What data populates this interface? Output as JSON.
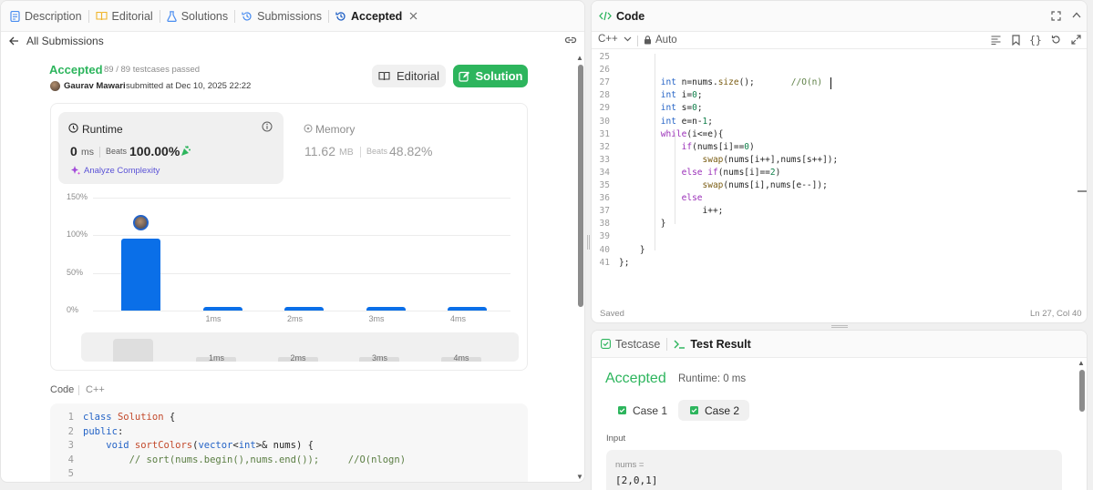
{
  "left_tabs": {
    "description": "Description",
    "editorial": "Editorial",
    "solutions": "Solutions",
    "submissions": "Submissions",
    "accepted": "Accepted"
  },
  "back_link": "All Submissions",
  "submission": {
    "status": "Accepted",
    "testcases": "89 / 89 testcases passed",
    "user": "Gaurav Mawari",
    "submitted_at": "submitted at Dec 10, 2025 22:22",
    "editorial_button": "Editorial",
    "solution_button": "Solution"
  },
  "runtime": {
    "label": "Runtime",
    "value": "0",
    "unit": "ms",
    "beats_label": "Beats",
    "beats_value": "100.00%",
    "analyze": "Analyze Complexity"
  },
  "memory": {
    "label": "Memory",
    "value": "11.62",
    "unit": "MB",
    "beats_label": "Beats",
    "beats_value": "48.82%"
  },
  "chart_data": {
    "type": "bar",
    "categories": [
      "0ms",
      "1ms",
      "2ms",
      "3ms",
      "4ms"
    ],
    "x_tick_labels": [
      "",
      "1ms",
      "2ms",
      "3ms",
      "4ms"
    ],
    "values": [
      95,
      3,
      3,
      3,
      3
    ],
    "ylim": [
      0,
      150
    ],
    "y_ticks": [
      "150%",
      "100%",
      "50%",
      "0%"
    ],
    "grid": true,
    "highlight_category": "0ms",
    "mini_labels": [
      "1ms",
      "2ms",
      "3ms",
      "4ms"
    ]
  },
  "code_section": {
    "label": "Code",
    "language": "C++",
    "lines": [
      {
        "n": "1",
        "tokens": [
          [
            "kw",
            "class "
          ],
          [
            "cls",
            "Solution "
          ],
          [
            "",
            "{"
          ]
        ]
      },
      {
        "n": "2",
        "tokens": [
          [
            "kw",
            "public"
          ],
          [
            "",
            ":"
          ]
        ]
      },
      {
        "n": "3",
        "tokens": [
          [
            "",
            "    "
          ],
          [
            "ty",
            "void "
          ],
          [
            "cls",
            "sortColors"
          ],
          [
            "",
            "("
          ],
          [
            "ty",
            "vector"
          ],
          [
            "",
            "<"
          ],
          [
            "ty",
            "int"
          ],
          [
            "",
            ">& nums) {"
          ]
        ]
      },
      {
        "n": "4",
        "tokens": [
          [
            "",
            "        "
          ],
          [
            "cm",
            "// sort(nums.begin(),nums.end());     //O(nlogn)"
          ]
        ]
      },
      {
        "n": "5",
        "tokens": []
      }
    ]
  },
  "editor": {
    "title": "Code",
    "language": "C++",
    "auto": "Auto",
    "saved": "Saved",
    "cursor": "Ln 27, Col 40",
    "lines": [
      {
        "n": "25",
        "tokens": []
      },
      {
        "n": "26",
        "tokens": []
      },
      {
        "n": "27",
        "tokens": [
          [
            "",
            "        "
          ],
          [
            "ty",
            "int "
          ],
          [
            "",
            "n=nums."
          ],
          [
            "fn",
            "size"
          ],
          [
            "",
            "();       "
          ],
          [
            "cm",
            "//O(n)"
          ]
        ]
      },
      {
        "n": "28",
        "tokens": [
          [
            "",
            "        "
          ],
          [
            "ty",
            "int "
          ],
          [
            "",
            "i="
          ],
          [
            "nm",
            "0"
          ],
          [
            "",
            ";"
          ]
        ]
      },
      {
        "n": "29",
        "tokens": [
          [
            "",
            "        "
          ],
          [
            "ty",
            "int "
          ],
          [
            "",
            "s="
          ],
          [
            "nm",
            "0"
          ],
          [
            "",
            ";"
          ]
        ]
      },
      {
        "n": "30",
        "tokens": [
          [
            "",
            "        "
          ],
          [
            "ty",
            "int "
          ],
          [
            "",
            "e=n-"
          ],
          [
            "nm",
            "1"
          ],
          [
            "",
            ";"
          ]
        ]
      },
      {
        "n": "31",
        "tokens": [
          [
            "",
            "        "
          ],
          [
            "pu",
            "while"
          ],
          [
            "",
            "(i<=e){"
          ]
        ]
      },
      {
        "n": "32",
        "tokens": [
          [
            "",
            "            "
          ],
          [
            "pu",
            "if"
          ],
          [
            "",
            "(nums[i]=="
          ],
          [
            "nm",
            "0"
          ],
          [
            "",
            ")"
          ]
        ]
      },
      {
        "n": "33",
        "tokens": [
          [
            "",
            "                "
          ],
          [
            "fn",
            "swap"
          ],
          [
            "",
            "(nums[i++],nums[s++]);"
          ]
        ]
      },
      {
        "n": "34",
        "tokens": [
          [
            "",
            "            "
          ],
          [
            "pu",
            "else if"
          ],
          [
            "",
            "(nums[i]=="
          ],
          [
            "nm",
            "2"
          ],
          [
            "",
            ")"
          ]
        ]
      },
      {
        "n": "35",
        "tokens": [
          [
            "",
            "                "
          ],
          [
            "fn",
            "swap"
          ],
          [
            "",
            "(nums[i],nums[e--]);"
          ]
        ]
      },
      {
        "n": "36",
        "tokens": [
          [
            "",
            "            "
          ],
          [
            "pu",
            "else"
          ]
        ]
      },
      {
        "n": "37",
        "tokens": [
          [
            "",
            "                "
          ],
          [
            "",
            "i++;"
          ]
        ]
      },
      {
        "n": "38",
        "tokens": [
          [
            "",
            "        "
          ],
          [
            "",
            "}"
          ]
        ]
      },
      {
        "n": "39",
        "tokens": []
      },
      {
        "n": "40",
        "tokens": [
          [
            "",
            "    "
          ],
          [
            "",
            "}"
          ]
        ]
      },
      {
        "n": "41",
        "tokens": [
          [
            "",
            "};"
          ]
        ]
      }
    ]
  },
  "result": {
    "testcase_tab": "Testcase",
    "result_tab": "Test Result",
    "status": "Accepted",
    "runtime": "Runtime: 0 ms",
    "case1": "Case 1",
    "case2": "Case 2",
    "input_label": "Input",
    "var_name": "nums =",
    "var_value": "[2,0,1]"
  },
  "colors": {
    "accepted_green": "#2db55d",
    "bar_blue": "#0a6fe8",
    "solution_button": "#2db55d"
  }
}
